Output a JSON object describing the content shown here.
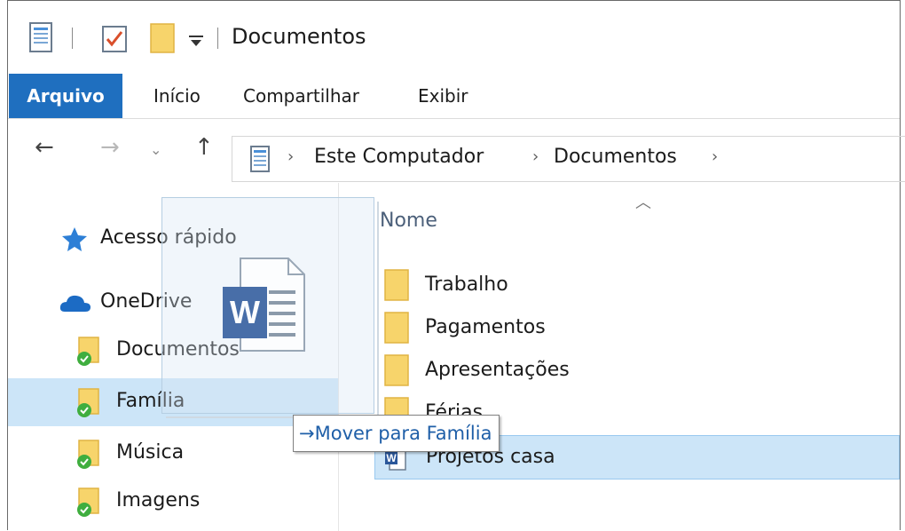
{
  "window": {
    "title": "Documentos"
  },
  "quick_access_toolbar": {
    "icons": [
      "properties-icon",
      "checklist-icon",
      "new-folder-icon",
      "customize-dropdown-icon"
    ]
  },
  "ribbon": {
    "tabs": [
      {
        "label": "Arquivo",
        "active": true
      },
      {
        "label": "Início"
      },
      {
        "label": "Compartilhar"
      },
      {
        "label": "Exibir"
      }
    ]
  },
  "address_bar": {
    "breadcrumb": [
      "Este Computador",
      "Documentos"
    ]
  },
  "nav_pane": {
    "items": [
      {
        "label": "Acesso rápido",
        "icon": "star-icon"
      },
      {
        "label": "OneDrive",
        "icon": "cloud-icon"
      },
      {
        "label": "Documentos",
        "icon": "synced-folder-icon"
      },
      {
        "label": "Família",
        "icon": "synced-folder-icon",
        "selected": true
      },
      {
        "label": "Música",
        "icon": "synced-folder-icon"
      },
      {
        "label": "Imagens",
        "icon": "synced-folder-icon"
      }
    ]
  },
  "content": {
    "column_header": "Nome",
    "items": [
      {
        "label": "Trabalho",
        "type": "folder"
      },
      {
        "label": "Pagamentos",
        "type": "folder"
      },
      {
        "label": "Apresentações",
        "type": "folder"
      },
      {
        "label": "Férias",
        "type": "folder"
      },
      {
        "label": "Projetos casa",
        "type": "word-document",
        "selected": true
      }
    ]
  },
  "drag": {
    "tooltip": "Mover para Família",
    "file_icon": "word-document-icon"
  },
  "colors": {
    "accent": "#1f6fbf",
    "selection": "#cce5f8",
    "folder": "#f7d46b"
  }
}
